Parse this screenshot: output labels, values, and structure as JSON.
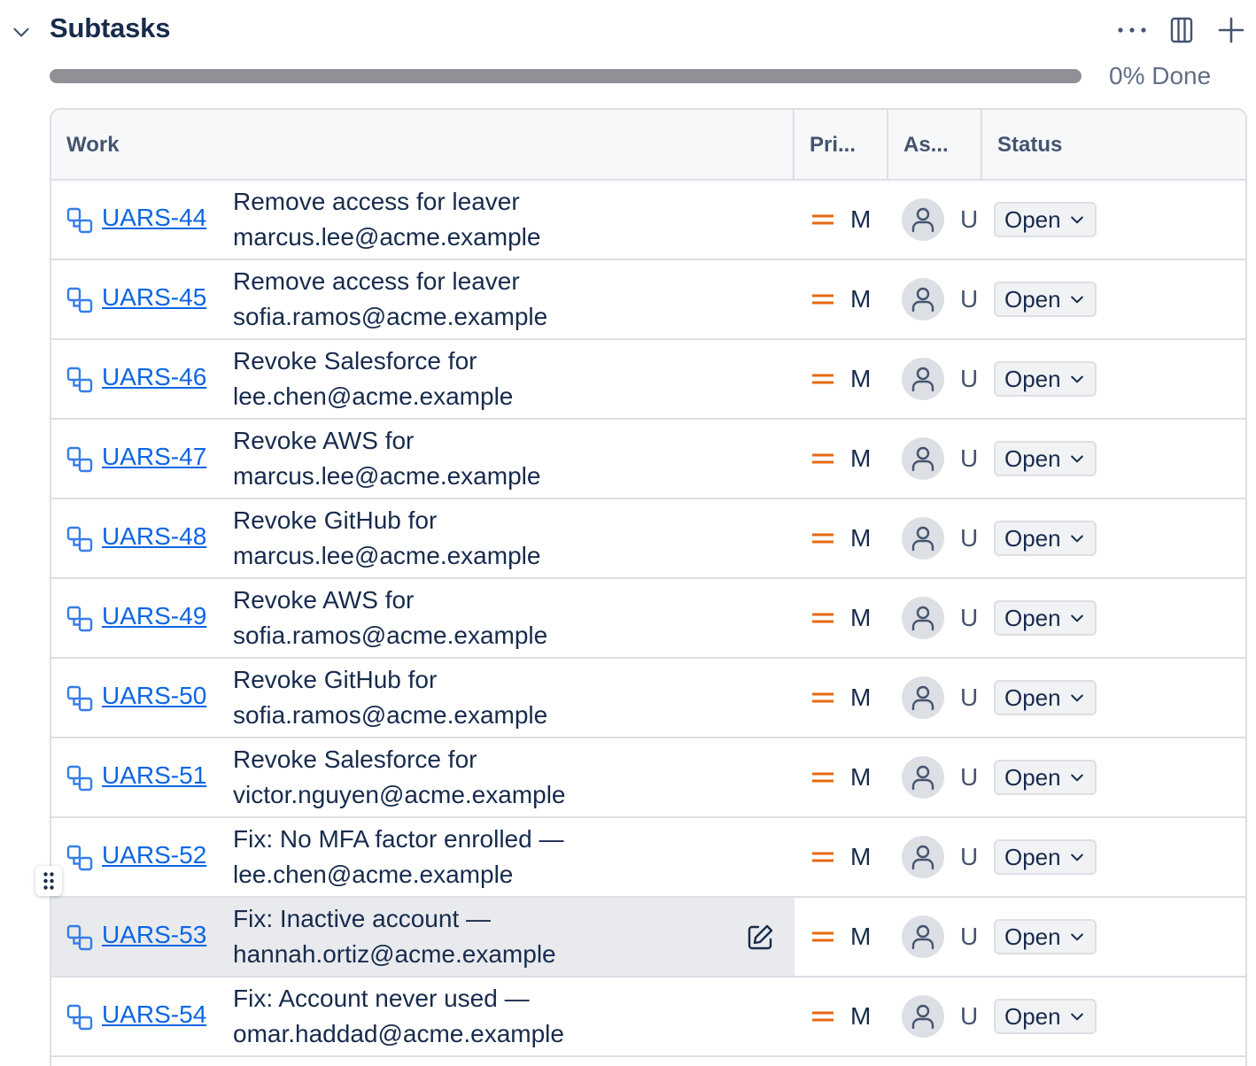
{
  "header": {
    "title": "Subtasks",
    "icons": [
      "chevron-down-icon",
      "more-icon",
      "columns-icon",
      "plus-icon"
    ]
  },
  "progress": {
    "percent_done": 0,
    "label": "0% Done"
  },
  "table": {
    "columns": [
      "Work",
      "Pri...",
      "As...",
      "Status"
    ],
    "rows": [
      {
        "key": "UARS-44",
        "summary": "Remove access for leaver marcus.lee@acme.example",
        "priority": "M",
        "assignee": "U",
        "status": "Open"
      },
      {
        "key": "UARS-45",
        "summary": "Remove access for leaver sofia.ramos@acme.example",
        "priority": "M",
        "assignee": "U",
        "status": "Open"
      },
      {
        "key": "UARS-46",
        "summary": "Revoke Salesforce for lee.chen@acme.example",
        "priority": "M",
        "assignee": "U",
        "status": "Open"
      },
      {
        "key": "UARS-47",
        "summary": "Revoke AWS for marcus.lee@acme.example",
        "priority": "M",
        "assignee": "U",
        "status": "Open"
      },
      {
        "key": "UARS-48",
        "summary": "Revoke GitHub for marcus.lee@acme.example",
        "priority": "M",
        "assignee": "U",
        "status": "Open"
      },
      {
        "key": "UARS-49",
        "summary": "Revoke AWS for sofia.ramos@acme.example",
        "priority": "M",
        "assignee": "U",
        "status": "Open"
      },
      {
        "key": "UARS-50",
        "summary": "Revoke GitHub for sofia.ramos@acme.example",
        "priority": "M",
        "assignee": "U",
        "status": "Open"
      },
      {
        "key": "UARS-51",
        "summary": "Revoke Salesforce for victor.nguyen@acme.example",
        "priority": "M",
        "assignee": "U",
        "status": "Open"
      },
      {
        "key": "UARS-52",
        "summary": "Fix: No MFA factor enrolled — lee.chen@acme.example",
        "priority": "M",
        "assignee": "U",
        "status": "Open"
      },
      {
        "key": "UARS-53",
        "summary": "Fix: Inactive account — hannah.ortiz@acme.example",
        "priority": "M",
        "assignee": "U",
        "status": "Open",
        "hovered": true
      },
      {
        "key": "UARS-54",
        "summary": "Fix: Account never used — omar.haddad@acme.example",
        "priority": "M",
        "assignee": "U",
        "status": "Open"
      }
    ]
  },
  "colors": {
    "link": "#0c66e4",
    "priority_medium": "#e56910",
    "progress_track": "#8f9197",
    "border": "#dcdfe4",
    "hover_row": "#e9eaed"
  }
}
